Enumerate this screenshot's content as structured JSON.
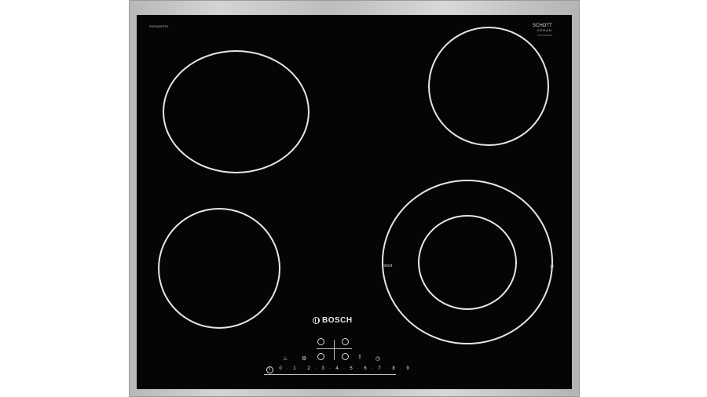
{
  "hob": {
    "brand": "BOSCH",
    "model": "PKF645FP1E",
    "glass_brand_top": "SCHOTT",
    "glass_brand_bottom": "CERAN",
    "glass_brand_tiny": "PKF645FP1E",
    "boost_label": "boost",
    "extended_zone_symbol": "◎"
  },
  "controls": {
    "zone_icons": [
      "zone-top-left-button",
      "zone-top-right-button",
      "zone-bottom-left-button",
      "zone-bottom-right-button"
    ],
    "icons": {
      "child_lock": "♨",
      "settings": "⚙",
      "boost": "⇧",
      "timer": "◷"
    },
    "power_symbol": "I",
    "power_level_labels": [
      "0",
      "1",
      "2",
      "3",
      "4",
      "5",
      "6",
      "7",
      "8",
      "9"
    ]
  }
}
